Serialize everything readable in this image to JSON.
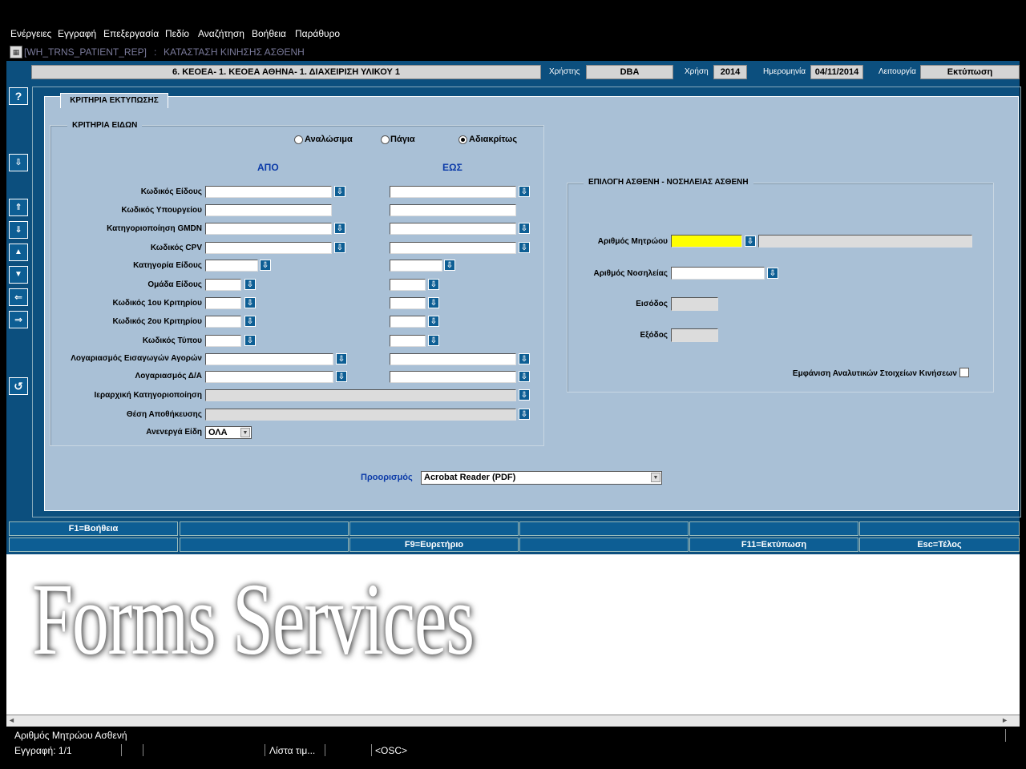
{
  "menu": [
    "Ενέργειες",
    "Εγγραφή",
    "Επεξεργασία",
    "Πεδίο",
    "Αναζήτηση",
    "Βοήθεια",
    "Παράθυρο"
  ],
  "window": {
    "form_code": "[WH_TRNS_PATIENT_REP]",
    "separator": ":",
    "title": "ΚΑΤΑΣΤΑΣΗ ΚΙΝΗΣΗΣ ΑΣΘΕΝΗ"
  },
  "header": {
    "org": "6. ΚΕΟΕΑ- 1. ΚΕΟΕΑ ΑΘΗΝΑ- 1. ΔΙΑΧΕΙΡΙΣΗ ΥΛΙΚΟΥ 1",
    "user_label": "Χρήστης",
    "user": "DBA",
    "year_label": "Χρήση",
    "year": "2014",
    "date_label": "Ημερομηνία",
    "date": "04/11/2014",
    "function_label": "Λειτουργία",
    "function": "Εκτύπωση"
  },
  "tab": "ΚΡΙΤΗΡΙΑ ΕΚΤΥΠΩΣΗΣ",
  "items_group": {
    "title": "ΚΡΙΤΗΡΙΑ ΕΙΔΩΝ",
    "radios": [
      {
        "label": "Αναλώσιμα",
        "checked": false
      },
      {
        "label": "Πάγια",
        "checked": false
      },
      {
        "label": "Αδιακρίτως",
        "checked": true
      }
    ],
    "from_label": "ΑΠΟ",
    "to_label": "ΕΩΣ",
    "rows": [
      "Κωδικός Είδους",
      "Κωδικός Υπουργείου",
      "Κατηγοριοποίηση GMDN",
      "Κωδικός CPV",
      "Κατηγορία Είδους",
      "Ομάδα Είδους",
      "Κωδικός 1ου Κριτηρίου",
      "Κωδικός 2ου Κριτηρίου",
      "Κωδικός Τύπου",
      "Λογαριασμός Εισαγωγών Αγορών",
      "Λογαριασμός Δ/Α",
      "Ιεραρχική Κατηγοριοποίηση",
      "Θέση Αποθήκευσης",
      "Ανενεργά Είδη"
    ],
    "inactive_value": "ΟΛΑ"
  },
  "patient_group": {
    "title": "ΕΠΙΛΟΓΗ ΑΣΘΕΝΗ - ΝΟΣΗΛΕΙΑΣ ΑΣΘΕΝΗ",
    "registry_label": "Αριθμός Μητρώου",
    "admission_label": "Αριθμός Νοσηλείας",
    "entry_label": "Εισόδος",
    "exit_label": "Εξόδος",
    "detail_label": "Εμφάνιση Αναλυτικών Στοιχείων Κινήσεων",
    "detail_checked": false
  },
  "destination": {
    "label": "Προορισμός",
    "value": "Acrobat Reader (PDF)"
  },
  "fkeys_row1": [
    "F1=Βοήθεια",
    "",
    "",
    "",
    "",
    ""
  ],
  "fkeys_row2": [
    "",
    "",
    "F9=Ευρετήριο",
    "",
    "F11=Εκτύπωση",
    "Esc=Τέλος"
  ],
  "watermark": "Forms Services",
  "status": {
    "hint": "Αριθμός Μητρώου Ασθενή",
    "record": "Εγγραφή: 1/1",
    "list": "Λίστα τιμ...",
    "osc": "<OSC>"
  },
  "colors": {
    "app_bg": "#0c4f7e",
    "panel_bg": "#a9c0d6",
    "highlight": "#ffff00"
  }
}
